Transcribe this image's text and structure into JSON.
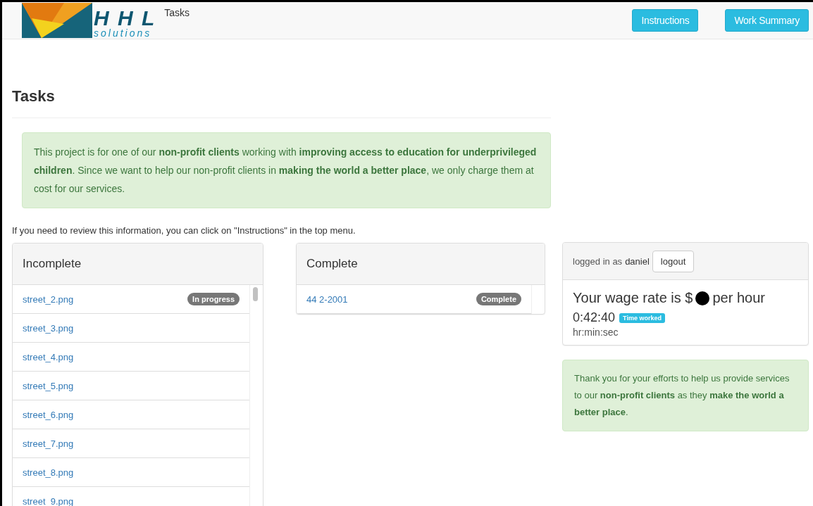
{
  "navbar": {
    "logo": {
      "title": "H H L",
      "subtitle": "solutions"
    },
    "brand": "Tasks",
    "buttons": [
      {
        "label": "Instructions"
      },
      {
        "label": "Work Summary"
      }
    ]
  },
  "page_title": "Tasks",
  "notice": "This project is for one of our **non-profit clients** working with **improving access to education for underprivileged children**. Since we want to help our non-profit clients in **making the world a better place**, we only charge them at cost for our services.",
  "hint": "If you need to review this information, you can click on \"Instructions\" in the top menu.",
  "incomplete": {
    "title": "Incomplete",
    "items": [
      {
        "name": "street_2.png",
        "badge": "In progress"
      },
      {
        "name": "street_3.png"
      },
      {
        "name": "street_4.png"
      },
      {
        "name": "street_5.png"
      },
      {
        "name": "street_6.png"
      },
      {
        "name": "street_7.png"
      },
      {
        "name": "street_8.png"
      },
      {
        "name": "street_9.png"
      }
    ]
  },
  "complete": {
    "title": "Complete",
    "items": [
      {
        "name": "44 2-2001",
        "badge": "Complete"
      }
    ]
  },
  "session": {
    "logged_in_label": "logged in as",
    "user": "daniel",
    "logout": "logout",
    "wage_before": "Your wage rate is $",
    "wage_redacted": true,
    "wage_after": "per hour",
    "time": "0:42:40",
    "time_badge": "Time worked",
    "time_unit": "hr:min:sec"
  },
  "thanks": "Thank you for your efforts to help us provide services to our **non-profit clients** as they **make the world a better place**."
}
